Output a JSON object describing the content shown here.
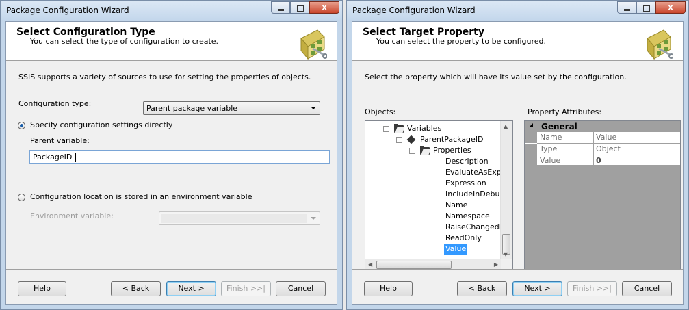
{
  "windows": [
    {
      "title": "Package Configuration Wizard",
      "header": {
        "title": "Select Configuration Type",
        "subtitle": "You can select the type of configuration to create."
      },
      "intro": "SSIS supports a variety of sources to use for setting the properties of objects.",
      "config_type_label": "Configuration type:",
      "config_type_value": "Parent package variable",
      "radio_direct_label": "Specify configuration settings directly",
      "parent_variable_label": "Parent variable:",
      "parent_variable_value": "PackageID",
      "radio_env_label": "Configuration location is stored in an environment variable",
      "env_variable_label": "Environment variable:",
      "env_variable_value": "",
      "buttons": {
        "help": "Help",
        "back": "< Back",
        "next": "Next >",
        "finish": "Finish >>|",
        "cancel": "Cancel"
      }
    },
    {
      "title": "Package Configuration Wizard",
      "header": {
        "title": "Select Target Property",
        "subtitle": "You can select the property to be configured."
      },
      "intro": "Select the property which will have its value set by the configuration.",
      "objects_label": "Objects:",
      "property_attributes_label": "Property Attributes:",
      "tree": {
        "variables": "Variables",
        "parent_package_id": "ParentPackageID",
        "properties": "Properties",
        "items": [
          "Description",
          "EvaluateAsExpressi",
          "Expression",
          "IncludeInDebugDur",
          "Name",
          "Namespace",
          "RaiseChangedEver",
          "ReadOnly",
          "Value"
        ],
        "selected": "Value"
      },
      "property_grid": {
        "category": "General",
        "rows": [
          {
            "name": "Name",
            "value": "Value"
          },
          {
            "name": "Type",
            "value": "Object"
          },
          {
            "name": "Value",
            "value": "0"
          }
        ]
      },
      "buttons": {
        "help": "Help",
        "back": "< Back",
        "next": "Next >",
        "finish": "Finish >>|",
        "cancel": "Cancel"
      }
    }
  ],
  "window_controls": {
    "minimize": "minimize-icon",
    "maximize": "maximize-icon",
    "close": "close-icon",
    "close_glyph": "x"
  },
  "colors": {
    "selection": "#3399ff",
    "title_bar": "#c3d6ea",
    "close_button": "#c9452b"
  }
}
